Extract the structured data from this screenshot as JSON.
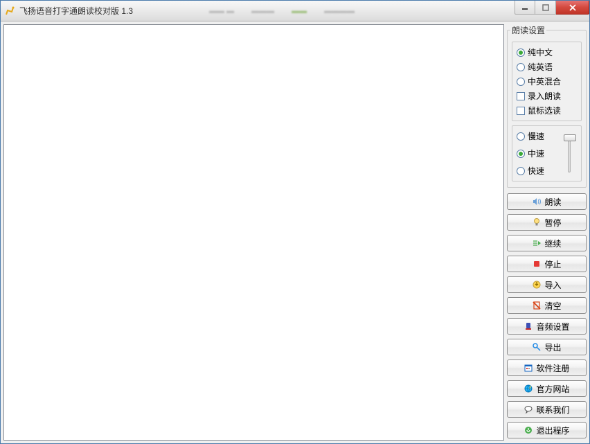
{
  "window": {
    "title": "飞扬语音打字通朗读校对版 1.3"
  },
  "textarea": {
    "value": ""
  },
  "settings": {
    "legend": "朗读设置",
    "lang": {
      "cn": "纯中文",
      "en": "纯英语",
      "mix": "中英混合",
      "input_read": "录入朗读",
      "mouse_read": "鼠标选读"
    },
    "speed": {
      "slow": "慢速",
      "mid": "中速",
      "fast": "快速"
    },
    "selected_lang": "cn",
    "selected_speed": "mid"
  },
  "buttons": {
    "read": "朗读",
    "pause": "暂停",
    "continue": "继续",
    "stop": "停止",
    "import": "导入",
    "clear": "清空",
    "audio": "音频设置",
    "export": "导出",
    "register": "软件注册",
    "website": "官方网站",
    "contact": "联系我们",
    "exit": "退出程序"
  }
}
